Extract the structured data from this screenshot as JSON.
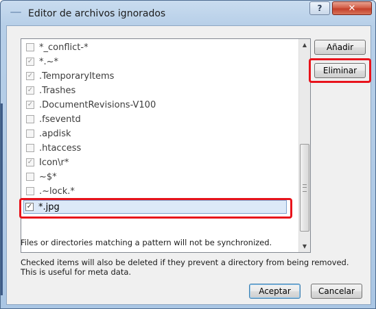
{
  "window": {
    "title": "Editor de archivos ignorados",
    "help_glyph": "?",
    "close_glyph": "✕"
  },
  "list": {
    "items": [
      {
        "label": "*_conflict-*",
        "checked": false
      },
      {
        "label": "*.~*",
        "checked": true
      },
      {
        "label": ".TemporaryItems",
        "checked": true
      },
      {
        "label": ".Trashes",
        "checked": true
      },
      {
        "label": ".DocumentRevisions-V100",
        "checked": true
      },
      {
        "label": ".fseventd",
        "checked": false
      },
      {
        "label": ".apdisk",
        "checked": false
      },
      {
        "label": ".htaccess",
        "checked": false
      },
      {
        "label": "Icon\\r*",
        "checked": true
      },
      {
        "label": "~$*",
        "checked": false
      },
      {
        "label": ".~lock.*",
        "checked": false
      },
      {
        "label": "*.jpg",
        "checked": true,
        "selected": true
      }
    ],
    "check_glyph": "✓"
  },
  "buttons": {
    "add": "Añadir",
    "remove": "Eliminar",
    "accept": "Aceptar",
    "cancel": "Cancelar"
  },
  "notes": {
    "sync": "Files or directories matching a pattern will not be synchronized.",
    "delete": "Checked items will also be deleted if they prevent a directory from being removed. This is useful for meta data."
  },
  "colors": {
    "highlight": "#e8131b",
    "selection": "#dce9f8"
  }
}
